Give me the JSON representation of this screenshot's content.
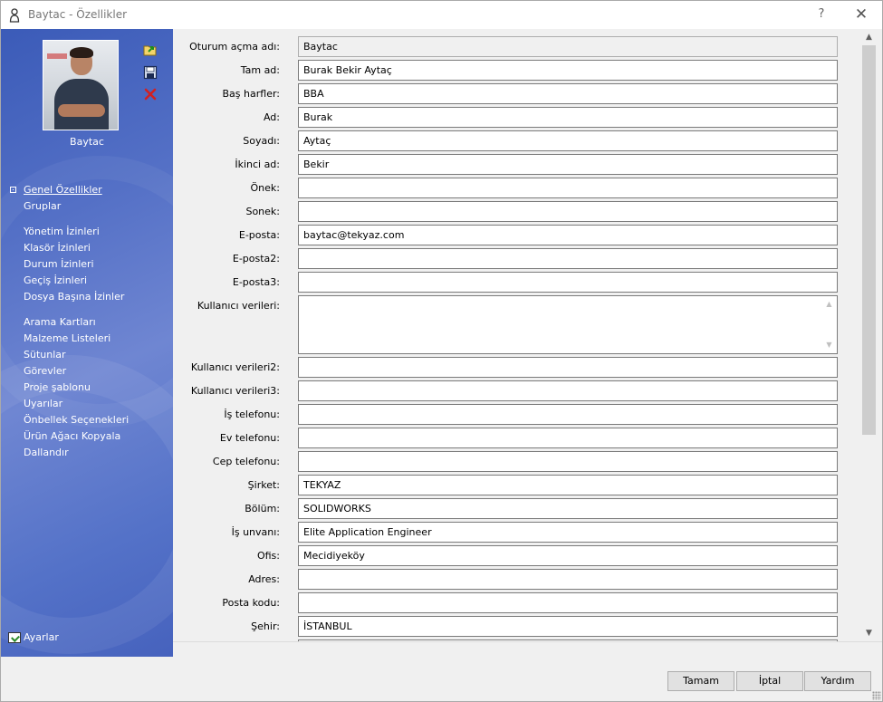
{
  "window": {
    "title": "Baytac - Özellikler",
    "help_label": "?",
    "close_label": "✕"
  },
  "sidebar": {
    "user_name": "Baytac",
    "icons": [
      "folder-arrow-icon",
      "save-icon",
      "delete-icon"
    ],
    "nav_items": [
      {
        "label": "Genel Özellikler",
        "active": true
      },
      {
        "label": "Gruplar"
      },
      {
        "label": "Yönetim İzinleri"
      },
      {
        "label": "Klasör İzinleri"
      },
      {
        "label": "Durum İzinleri"
      },
      {
        "label": "Geçiş İzinleri"
      },
      {
        "label": "Dosya Başına İzinler"
      },
      {
        "label": "Arama Kartları"
      },
      {
        "label": "Malzeme Listeleri"
      },
      {
        "label": "Sütunlar"
      },
      {
        "label": "Görevler"
      },
      {
        "label": "Proje şablonu"
      },
      {
        "label": "Uyarılar"
      },
      {
        "label": "Önbellek Seçenekleri"
      },
      {
        "label": "Ürün Ağacı Kopyala"
      },
      {
        "label": "Dallandır"
      }
    ],
    "settings_label": "Ayarlar"
  },
  "form": {
    "fields": [
      {
        "label": "Oturum açma adı:",
        "value": "Baytac",
        "readonly": true
      },
      {
        "label": "Tam ad:",
        "value": "Burak Bekir Aytaç"
      },
      {
        "label": "Baş harfler:",
        "value": "BBA"
      },
      {
        "label": "Ad:",
        "value": "Burak"
      },
      {
        "label": "Soyadı:",
        "value": "Aytaç"
      },
      {
        "label": "İkinci ad:",
        "value": "Bekir"
      },
      {
        "label": "Önek:",
        "value": ""
      },
      {
        "label": "Sonek:",
        "value": ""
      },
      {
        "label": "E-posta:",
        "value": "baytac@tekyaz.com"
      },
      {
        "label": "E-posta2:",
        "value": ""
      },
      {
        "label": "E-posta3:",
        "value": ""
      },
      {
        "label": "Kullanıcı verileri:",
        "value": "",
        "multiline": true
      },
      {
        "label": "Kullanıcı verileri2:",
        "value": ""
      },
      {
        "label": "Kullanıcı verileri3:",
        "value": ""
      },
      {
        "label": "İş telefonu:",
        "value": ""
      },
      {
        "label": "Ev telefonu:",
        "value": ""
      },
      {
        "label": "Cep telefonu:",
        "value": ""
      },
      {
        "label": "Şirket:",
        "value": "TEKYAZ"
      },
      {
        "label": "Bölüm:",
        "value": "SOLIDWORKS"
      },
      {
        "label": "İş unvanı:",
        "value": "Elite Application Engineer"
      },
      {
        "label": "Ofis:",
        "value": "Mecidiyeköy"
      },
      {
        "label": "Adres:",
        "value": ""
      },
      {
        "label": "Posta kodu:",
        "value": ""
      },
      {
        "label": "Şehir:",
        "value": "İSTANBUL"
      }
    ]
  },
  "footer": {
    "ok_label": "Tamam",
    "cancel_label": "İptal",
    "help_label": "Yardım"
  },
  "colors": {
    "sidebar_accent": "#4d68c2",
    "delete_icon": "#d32020"
  }
}
